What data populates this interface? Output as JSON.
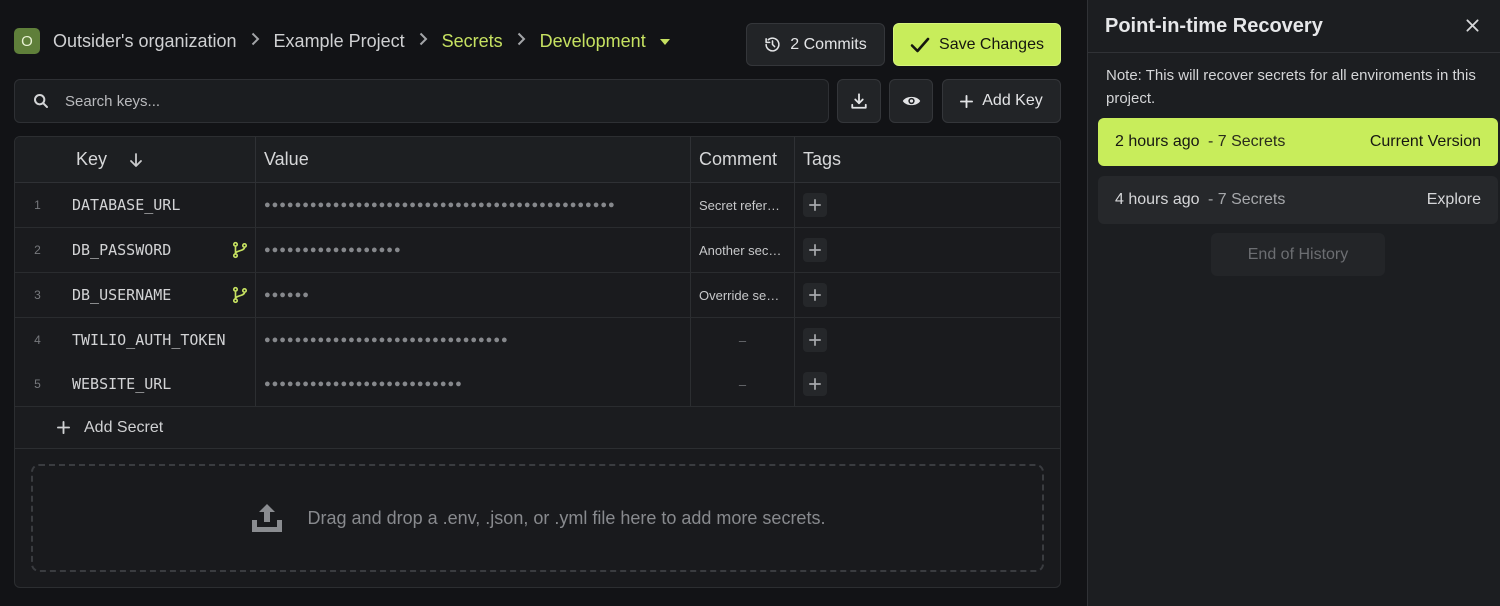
{
  "breadcrumb": {
    "avatar_letter": "O",
    "organization": "Outsider's organization",
    "project": "Example Project",
    "section": "Secrets",
    "environment": "Development"
  },
  "toolbar": {
    "commits_label": "2 Commits",
    "save_label": "Save Changes",
    "search_placeholder": "Search keys...",
    "add_key_label": "Add Key"
  },
  "table": {
    "columns": {
      "key": "Key",
      "value": "Value",
      "comment": "Comment",
      "tags": "Tags"
    },
    "rows": [
      {
        "num": "1",
        "key": "DATABASE_URL",
        "masked": "●●●●●●●●●●●●●●●●●●●●●●●●●●●●●●●●●●●●●●●●●●●●●●",
        "comment": "Secret refer…",
        "override": false
      },
      {
        "num": "2",
        "key": "DB_PASSWORD",
        "masked": "●●●●●●●●●●●●●●●●●●",
        "comment": "Another sec…",
        "override": true
      },
      {
        "num": "3",
        "key": "DB_USERNAME",
        "masked": "●●●●●●",
        "comment": "Override se…",
        "override": true
      },
      {
        "num": "4",
        "key": "TWILIO_AUTH_TOKEN",
        "masked": "●●●●●●●●●●●●●●●●●●●●●●●●●●●●●●●●",
        "comment": "–",
        "override": false
      },
      {
        "num": "5",
        "key": "WEBSITE_URL",
        "masked": "●●●●●●●●●●●●●●●●●●●●●●●●●●",
        "comment": "–",
        "override": false
      }
    ],
    "add_secret_label": "Add Secret"
  },
  "dropzone": {
    "text": "Drag and drop a .env, .json, or .yml file here to add more secrets."
  },
  "panel": {
    "title": "Point-in-time Recovery",
    "note": "Note: This will recover secrets for all enviroments in this project.",
    "versions": [
      {
        "time": "2 hours ago",
        "secrets": "- 7 Secrets",
        "action": "Current Version"
      },
      {
        "time": "4 hours ago",
        "secrets": "- 7 Secrets",
        "action": "Explore"
      }
    ],
    "end_label": "End of History"
  },
  "colors": {
    "accent": "#c8ed5b",
    "background": "#121316",
    "panel": "#1c1e21"
  },
  "icons": [
    "history-icon",
    "check-icon",
    "search-icon",
    "download-icon",
    "eye-icon",
    "plus-icon",
    "sort-arrow-icon",
    "branch-icon",
    "upload-icon",
    "close-icon"
  ]
}
